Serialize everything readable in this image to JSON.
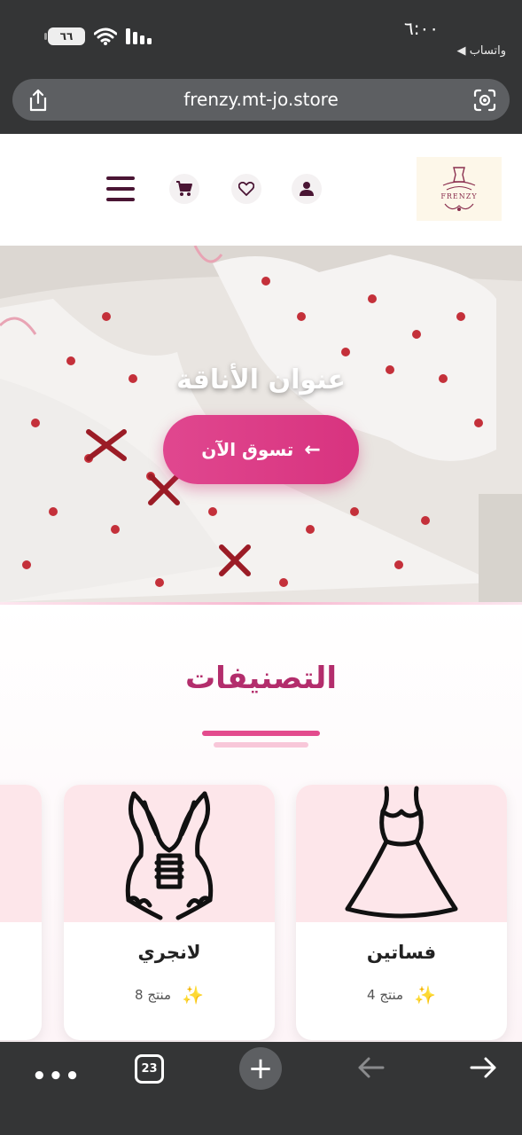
{
  "status": {
    "time": "٦:٠٠",
    "back_label": "◀ واتساب",
    "battery": "٦٦"
  },
  "browser": {
    "url": "frenzy.mt-jo.store",
    "tabs_count": "23"
  },
  "header": {
    "logo_text": "FRENZY"
  },
  "hero": {
    "title": "عنوان الأناقة",
    "cta_label": "تسوق الآن",
    "cta_arrow": "←"
  },
  "categories": {
    "title": "التصنيفات",
    "items": [
      {
        "name": "فساتين",
        "count": "4 منتج",
        "icon": "dress-icon"
      },
      {
        "name": "لانجري",
        "count": "8 منتج",
        "icon": "lingerie-icon"
      }
    ],
    "sparkle": "✨"
  },
  "colors": {
    "accent": "#e0478f",
    "title": "#b32d6c",
    "chrome": "#343536"
  }
}
